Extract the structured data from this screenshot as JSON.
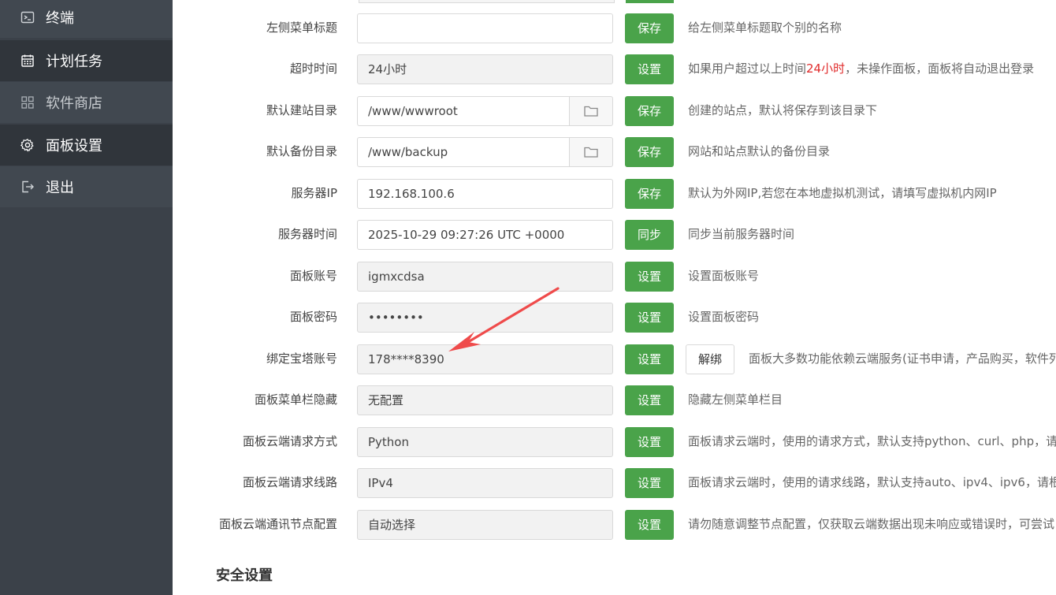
{
  "sidebar": {
    "items": [
      {
        "label": "终端",
        "icon": "terminal-icon"
      },
      {
        "label": "计划任务",
        "icon": "calendar-icon"
      },
      {
        "label": "软件商店",
        "icon": "grid-icon"
      },
      {
        "label": "面板设置",
        "icon": "gear-icon"
      },
      {
        "label": "退出",
        "icon": "logout-icon"
      }
    ]
  },
  "settings": {
    "menu_title": {
      "label": "左侧菜单标题",
      "value": "",
      "button": "保存",
      "desc": "给左侧菜单标题取个别的名称"
    },
    "timeout": {
      "label": "超时时间",
      "value": "24小时",
      "button": "设置",
      "desc_pre": "如果用户超过以上时间",
      "desc_hl": "24小时",
      "desc_post": "，未操作面板，面板将自动退出登录"
    },
    "site_dir": {
      "label": "默认建站目录",
      "value": "/www/wwwroot",
      "button": "保存",
      "desc": "创建的站点，默认将保存到该目录下"
    },
    "backup_dir": {
      "label": "默认备份目录",
      "value": "/www/backup",
      "button": "保存",
      "desc": "网站和站点默认的备份目录"
    },
    "server_ip": {
      "label": "服务器IP",
      "value": "192.168.100.6",
      "button": "保存",
      "desc": "默认为外网IP,若您在本地虚拟机测试，请填写虚拟机内网IP"
    },
    "server_time": {
      "label": "服务器时间",
      "value": "2025-10-29 09:27:26 UTC +0000",
      "button": "同步",
      "desc": "同步当前服务器时间"
    },
    "panel_account": {
      "label": "面板账号",
      "value": "igmxcdsa",
      "button": "设置",
      "desc": "设置面板账号"
    },
    "panel_password": {
      "label": "面板密码",
      "value": "••••••••",
      "button": "设置",
      "desc": "设置面板密码"
    },
    "bt_account": {
      "label": "绑定宝塔账号",
      "value": "178****8390",
      "button": "设置",
      "button2": "解绑",
      "desc": "面板大多数功能依赖云端服务(证书申请，产品购买，软件列"
    },
    "menu_hide": {
      "label": "面板菜单栏隐藏",
      "value": "无配置",
      "button": "设置",
      "desc": "隐藏左侧菜单栏目"
    },
    "cloud_method": {
      "label": "面板云端请求方式",
      "value": "Python",
      "button": "设置",
      "desc": "面板请求云端时，使用的请求方式，默认支持python、curl、php，请"
    },
    "cloud_line": {
      "label": "面板云端请求线路",
      "value": "IPv4",
      "button": "设置",
      "desc": "面板请求云端时，使用的请求线路，默认支持auto、ipv4、ipv6，请根"
    },
    "cloud_node": {
      "label": "面板云端通讯节点配置",
      "value": "自动选择",
      "button": "设置",
      "desc": "请勿随意调整节点配置，仅获取云端数据出现未响应或错误时，可尝试"
    }
  },
  "security": {
    "title": "安全设置"
  },
  "colors": {
    "sidebar_bg": "#3b4149",
    "accent_green": "#4aa34a",
    "highlight_red": "#e02a2a",
    "annotation_arrow": "#ef4b4b"
  }
}
